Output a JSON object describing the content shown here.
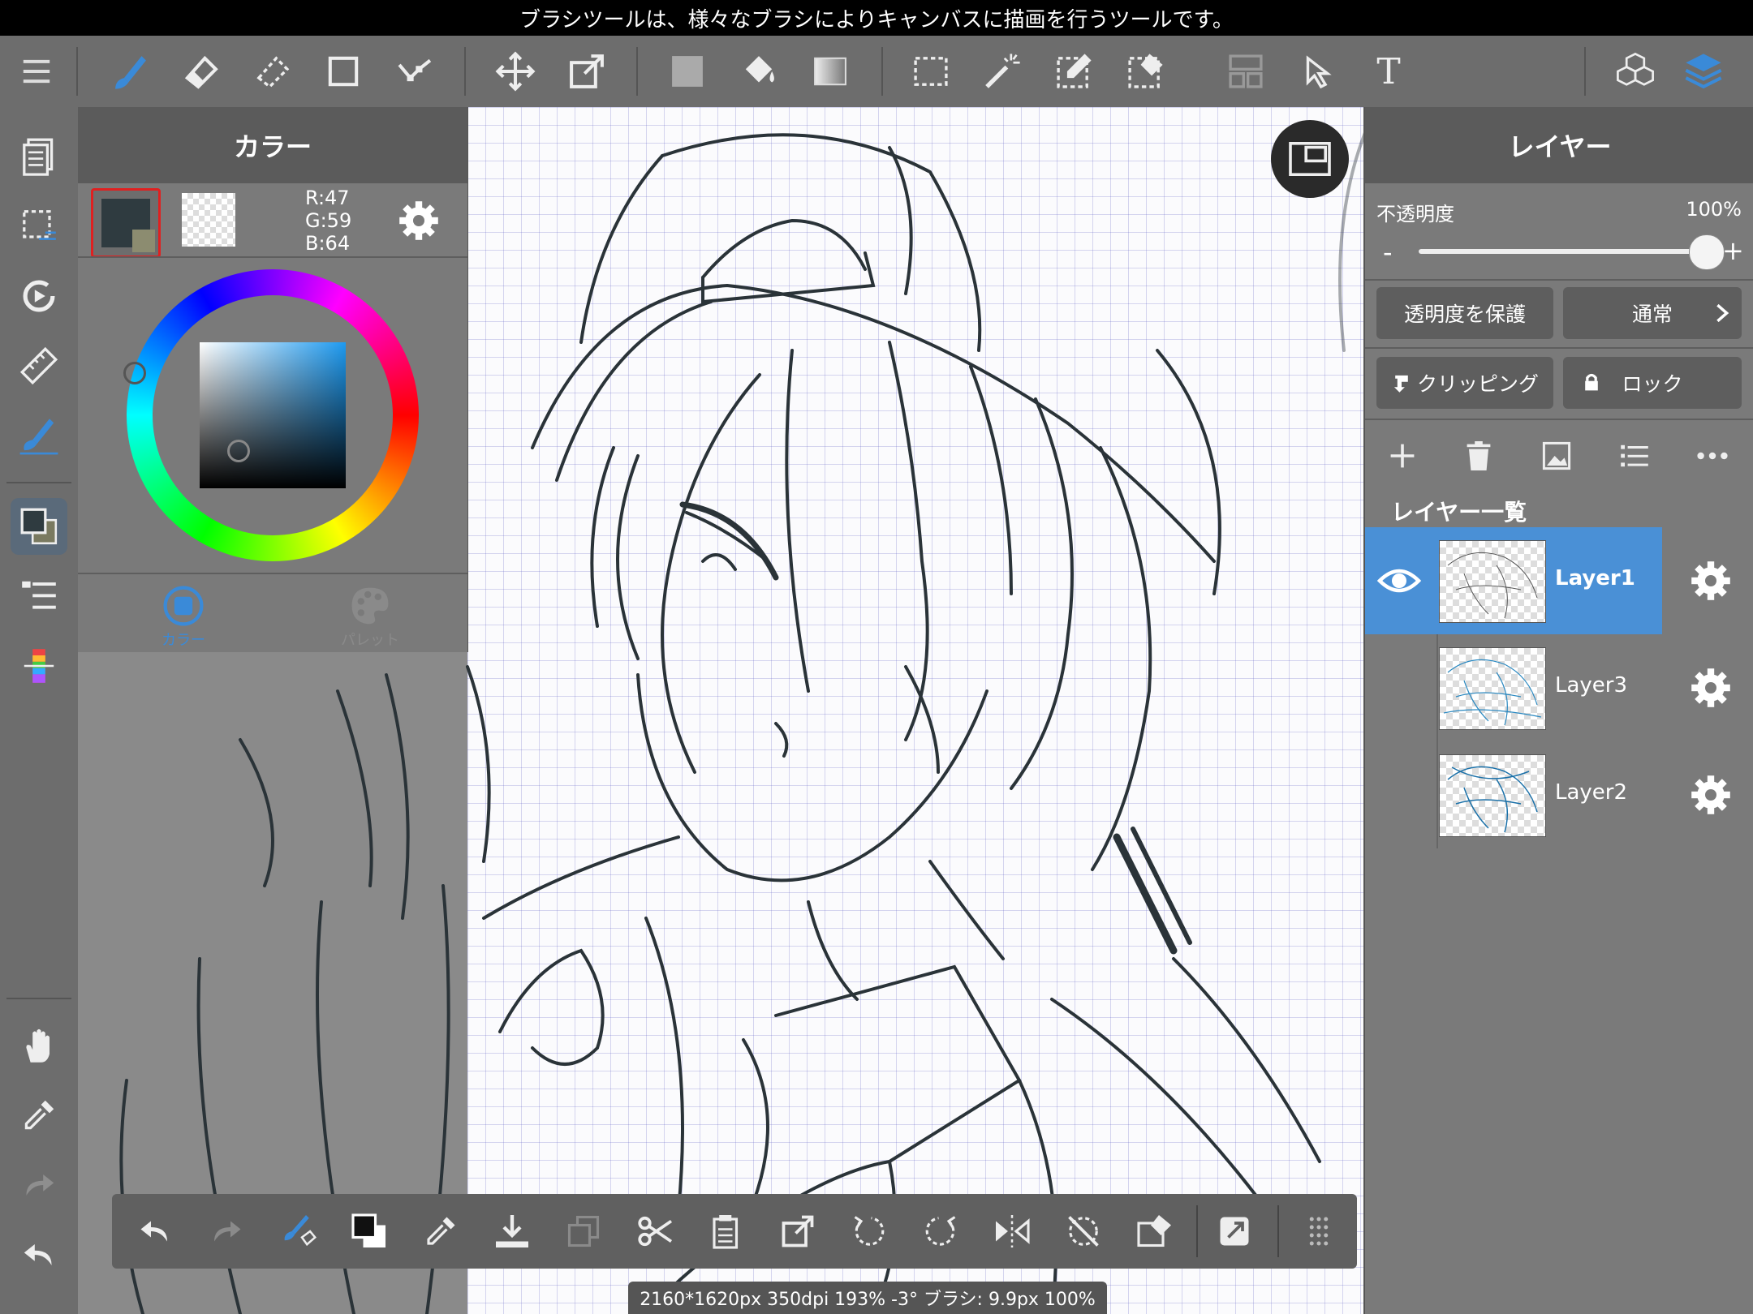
{
  "hint": "ブラシツールは、様々なブラシによりキャンバスに描画を行うツールです。",
  "color_panel": {
    "title": "カラー",
    "rgb": {
      "r": "R:47",
      "g": "G:59",
      "b": "B:64"
    },
    "tabs": [
      "カラー",
      "パレット"
    ],
    "primary_color": "#2f3b40"
  },
  "layer_panel": {
    "title": "レイヤー",
    "opacity_label": "不透明度",
    "opacity_value": "100%",
    "opacity_fraction": 1.0,
    "minus": "-",
    "plus": "+",
    "protect_alpha": "透明度を保護",
    "blend_mode": "通常",
    "clipping": "クリッピング",
    "lock": "ロック",
    "list_title": "レイヤー一覧",
    "layers": [
      {
        "name": "Layer1",
        "selected": true,
        "visible": true
      },
      {
        "name": "Layer3",
        "selected": false,
        "visible": false
      },
      {
        "name": "Layer2",
        "selected": false,
        "visible": false
      }
    ]
  },
  "status": "2160*1620px 350dpi 193% -3° ブラシ: 9.9px 100%",
  "text_tool": "T",
  "accent": "#3a8ad8"
}
